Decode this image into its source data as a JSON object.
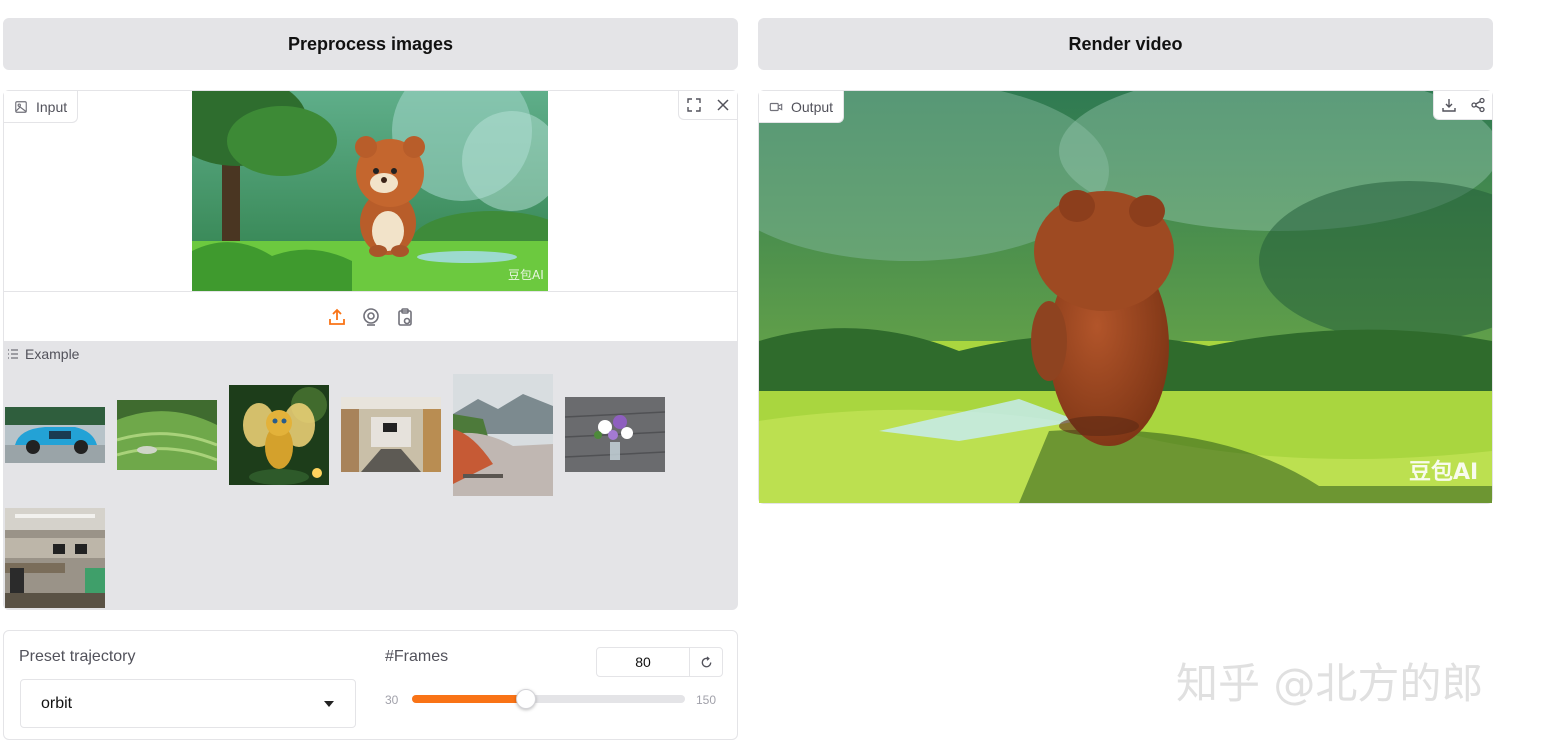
{
  "buttons": {
    "preprocess": "Preprocess images",
    "render": "Render video"
  },
  "input": {
    "label": "Input",
    "icons": [
      "image-icon",
      "fullscreen-icon",
      "close-icon",
      "upload-icon",
      "webcam-icon",
      "clipboard-icon"
    ]
  },
  "examples": {
    "label": "Example",
    "items": [
      "car",
      "terraced-hills",
      "golden-dragon",
      "meeting-room",
      "lake-mountains",
      "flower-vase",
      "computer-lab"
    ]
  },
  "output": {
    "label": "Output",
    "icons": [
      "video-icon",
      "download-icon",
      "share-icon"
    ]
  },
  "controls": {
    "trajectory_label": "Preset trajectory",
    "trajectory_value": "orbit",
    "frames_label": "#Frames",
    "frames_value": "80",
    "frames_min": "30",
    "frames_max": "150",
    "frames_fraction": 0.4167
  },
  "watermark": "知乎 @北方的郎",
  "colors": {
    "accent": "#f97316",
    "panel_gray": "#e4e4e7"
  }
}
